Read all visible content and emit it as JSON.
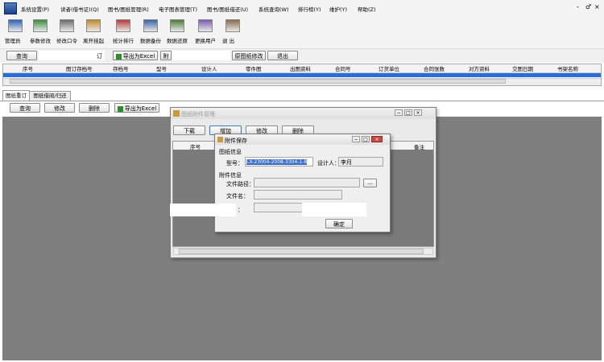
{
  "menu": {
    "items": [
      "系统设置(P)",
      "读者(借书证)(Q)",
      "图书/图纸管理(R)",
      "电子图表管理(T)",
      "图书/图纸借还(U)",
      "系统查询(W)",
      "排行榜(Y)",
      "维护(Y)",
      "帮助(Z)"
    ],
    "window_controls": [
      "-",
      "♂",
      "×"
    ]
  },
  "toolbar": {
    "items": [
      {
        "label": "管理员",
        "icon": "admin-icon"
      },
      {
        "label": "参数修改",
        "icon": "settings-icon"
      },
      {
        "label": "修改口令",
        "icon": "key-icon"
      },
      {
        "label": "离开挂起",
        "icon": "suspend-icon"
      },
      {
        "label": "统计排行",
        "icon": "stats-icon"
      },
      {
        "label": "数据备份",
        "icon": "backup-icon"
      },
      {
        "label": "数据还原",
        "icon": "restore-icon"
      },
      {
        "label": "更换用户",
        "icon": "switch-user-icon"
      },
      {
        "label": "退  出",
        "icon": "exit-icon"
      }
    ]
  },
  "actions": {
    "query": "查询",
    "ding": "订",
    "export": "导出为Excel",
    "fu": "附",
    "modify_original": "原图纸修改",
    "exit": "退出"
  },
  "grid": {
    "headers": [
      "序号",
      "图订存档号",
      "存档号",
      "型号",
      "设计人",
      "零件图",
      "出图资料",
      "合同号",
      "订货单位",
      "合同张数",
      "对方资料",
      "交图日期",
      "书架名称"
    ]
  },
  "tabs": [
    "图纸重订",
    "图纸借阅/归还"
  ],
  "tab_actions": {
    "query": "查询",
    "modify": "修改",
    "delete": "删除",
    "export": "导出为Excel"
  },
  "attach_window": {
    "title": "图纸附件管理",
    "buttons": [
      "下载",
      "增加",
      "修改",
      "删除"
    ],
    "headers": [
      "序号",
      "备注"
    ]
  },
  "save_dialog": {
    "title": "附件保存",
    "group_info": "图纸信息",
    "model_label": "型号：",
    "model_value": "LX-23004-2008-3304-1-8",
    "designer_label": "设计人：",
    "designer_value": "李月",
    "group_attach": "附件信息",
    "path_label": "文件路径：",
    "path_value": "",
    "browse": "...",
    "filename_label": "文件名：",
    "filename_value": "",
    "remark_label": "：",
    "ok": "确定"
  }
}
